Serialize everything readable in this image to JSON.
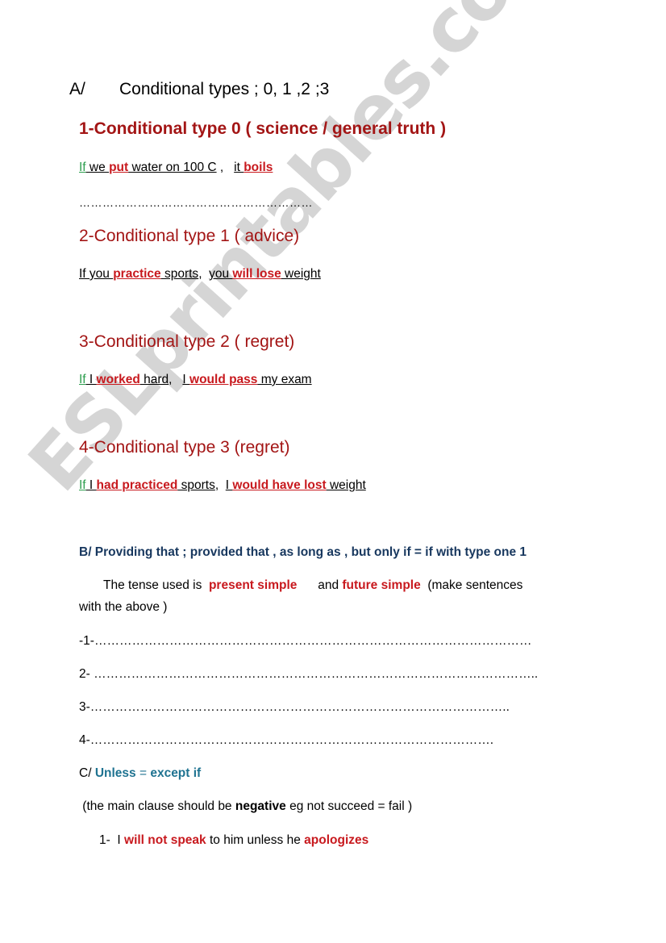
{
  "watermark": "ESLprintables.com",
  "colors": {
    "heading_red": "#a31515",
    "emphasis_red": "#c8191e",
    "if_green": "#2e9e4f",
    "section_b_navy": "#17375e",
    "section_c_teal": "#1f7391",
    "watermark_grey": "#d3d3d3"
  },
  "section_a": {
    "label": "A/",
    "title": "Conditional types ;  0, 1 ,2 ;3"
  },
  "types": [
    {
      "heading": "1-Conditional type 0 ( science / general truth )",
      "example": {
        "if": "If",
        "p1": " we ",
        "v1": "put",
        "p2": " water on 100 C",
        "sep": " ,   ",
        "p3": "it ",
        "v2": "boils"
      },
      "blank": "……………………………………………………"
    },
    {
      "heading": "2-Conditional type 1 ( advice)",
      "example": {
        "p1": "If you ",
        "v1": "practice",
        "p2": " sports",
        "sep": ",  ",
        "p3": "you ",
        "v2": "will lose",
        "p4": " weight"
      }
    },
    {
      "heading": "3-Conditional type  2 ( regret)",
      "example": {
        "if": "If",
        "p1": " I ",
        "v1": "worked",
        "p2": " hard",
        "sep": ",   ",
        "p3": "I ",
        "v2": "would pass",
        "p4": " my exam"
      }
    },
    {
      "heading": "4-Conditional type 3 (regret)",
      "example": {
        "if": "If",
        "p1": " I ",
        "v1": "had practiced",
        "p2": " sports",
        "sep": ",  ",
        "p3": "I ",
        "v2": "would have lost",
        "p4": " weight"
      }
    }
  ],
  "section_b": {
    "heading": "B/ Providing that  ; provided that , as long as , but only if =   if with type one  1",
    "tense_prefix": "The tense used is  ",
    "tense1": "present simple",
    "tense_mid": "      and ",
    "tense2": "future simple",
    "tense_suffix": "  (make sentences",
    "tense_line2": "with  the above )",
    "blanks": [
      "-1-……………………………………………………………………………………………",
      "2- ……………………………………………………………………………………………..",
      "3-………………………………………………………………………………………..",
      "4-……………………………………………………………………………………."
    ]
  },
  "section_c": {
    "label": "C/ ",
    "term": "Unless",
    "eq": " = ",
    "definition": "except if",
    "note_prefix": " (the main clause should be ",
    "note_bold": "negative",
    "note_suffix": " eg not succeed = fail )",
    "example_num": "1-  I ",
    "example_v1": "will not speak",
    "example_mid": " to him unless he ",
    "example_v2": "apologizes"
  }
}
